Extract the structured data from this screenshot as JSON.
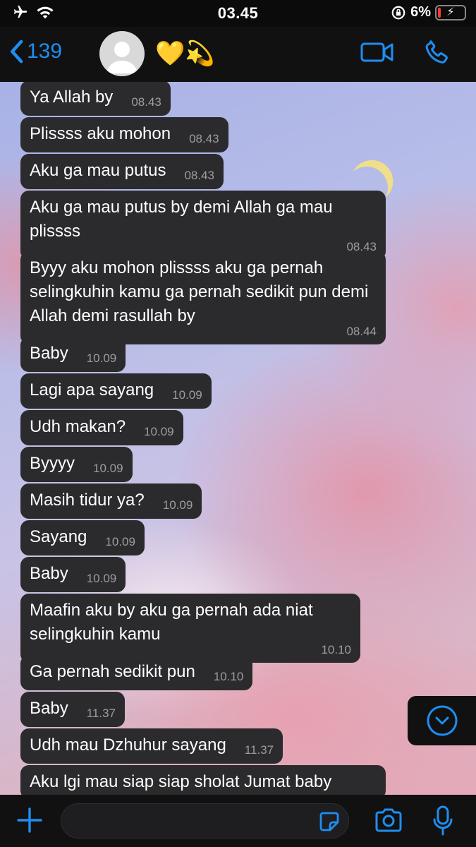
{
  "status": {
    "time": "03.45",
    "battery": "6%"
  },
  "header": {
    "back_count": "139",
    "contact_name": "💛💫"
  },
  "messages": [
    {
      "text": "Ya Allah by",
      "time": "08.43"
    },
    {
      "text": "Plissss aku mohon",
      "time": "08.43"
    },
    {
      "text": "Aku ga mau putus",
      "time": "08.43"
    },
    {
      "text": "Aku ga mau putus by demi Allah ga mau plissss",
      "time": "08.43"
    },
    {
      "text": "Byyy aku mohon plissss aku ga pernah selingkuhin kamu ga pernah sedikit pun demi Allah demi rasullah by",
      "time": "08.44"
    },
    {
      "text": "Baby",
      "time": "10.09"
    },
    {
      "text": "Lagi apa sayang",
      "time": "10.09"
    },
    {
      "text": "Udh makan?",
      "time": "10.09"
    },
    {
      "text": "Byyyy",
      "time": "10.09"
    },
    {
      "text": "Masih tidur ya?",
      "time": "10.09"
    },
    {
      "text": "Sayang",
      "time": "10.09"
    },
    {
      "text": "Baby",
      "time": "10.09"
    },
    {
      "text": "Maafin aku by aku ga pernah ada niat selingkuhin kamu",
      "time": "10.10"
    },
    {
      "text": "Ga pernah sedikit pun",
      "time": "10.10"
    },
    {
      "text": "Baby",
      "time": "11.37"
    },
    {
      "text": "Udh mau Dzhuhur sayang",
      "time": "11.37"
    },
    {
      "text": "Aku lgi mau siap siap sholat Jumat baby",
      "time": ""
    }
  ],
  "composer": {
    "placeholder": ""
  },
  "colors": {
    "accent": "#1e8ef2",
    "bubble": "#2b2b2e",
    "timestamp": "#9d9d9f"
  },
  "icons": [
    "airplane-icon",
    "wifi-icon",
    "rotation-lock-icon",
    "battery-icon",
    "chevron-left-icon",
    "avatar-icon",
    "video-call-icon",
    "phone-icon",
    "chevron-down-icon",
    "plus-icon",
    "sticker-icon",
    "camera-icon",
    "microphone-icon"
  ]
}
